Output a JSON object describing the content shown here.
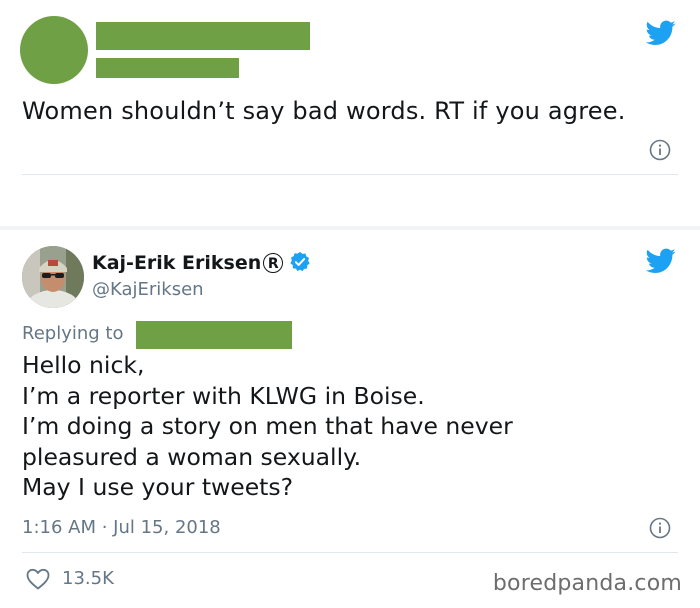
{
  "colors": {
    "redaction": "#70a046",
    "twitter_blue": "#1da1f2",
    "text_primary": "#14171a",
    "text_secondary": "#657786",
    "divider": "#e1e8ed"
  },
  "tweet_original": {
    "text": "Women shouldn’t say bad words. RT if you agree.",
    "bird_icon": "twitter-bird-icon",
    "info_icon": "info-icon"
  },
  "tweet_reply": {
    "author_name": "Kaj-Erik Eriksen",
    "registered_mark": "R",
    "handle": "@KajEriksen",
    "replying_to_label": "Replying to",
    "body_lines": [
      "Hello nick,",
      "I’m a reporter with KLWG in Boise.",
      "I’m doing a story on men that have never",
      "pleasured a woman sexually.",
      "May I use your tweets?"
    ],
    "timestamp": "1:16 AM · Jul 15, 2018",
    "likes": "13.5K",
    "bird_icon": "twitter-bird-icon",
    "verified_icon": "verified-badge-icon",
    "heart_icon": "heart-icon"
  },
  "watermark": "boredpanda.com"
}
